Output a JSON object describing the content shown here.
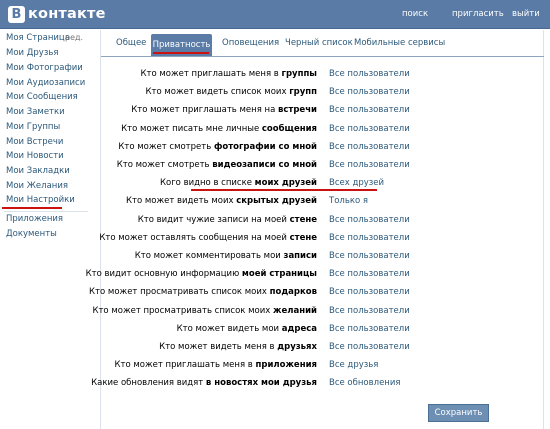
{
  "header": {
    "logo_letter": "В",
    "logo_text": "контакте",
    "links": [
      "поиск",
      "пригласить",
      "выйти"
    ]
  },
  "sidebar": {
    "edit_label": "ред.",
    "items": [
      "Моя Страница",
      "Мои Друзья",
      "Мои Фотографии",
      "Мои Аудиозаписи",
      "Мои Сообщения",
      "Мои Заметки",
      "Мои Группы",
      "Мои Встречи",
      "Мои Новости",
      "Мои Закладки",
      "Мои Желания",
      "Мои Настройки"
    ],
    "extra": [
      "Приложения",
      "Документы"
    ]
  },
  "tabs": [
    "Общее",
    "Приватность",
    "Оповещения",
    "Черный список",
    "Мобильные сервисы"
  ],
  "settings": [
    {
      "pre": "Кто может приглашать меня в ",
      "bold": "группы",
      "post": "",
      "value": "Все пользователи"
    },
    {
      "pre": "Кто может видеть список моих ",
      "bold": "групп",
      "post": "",
      "value": "Все пользователи"
    },
    {
      "pre": "Кто может приглашать меня на ",
      "bold": "встречи",
      "post": "",
      "value": "Все пользователи"
    },
    {
      "pre": "Кто может писать мне личные ",
      "bold": "сообщения",
      "post": "",
      "value": "Все пользователи"
    },
    {
      "pre": "Кто может смотреть ",
      "bold": "фотографии со мной",
      "post": "",
      "value": "Все пользователи"
    },
    {
      "pre": "Кто может смотреть ",
      "bold": "видеозаписи со мной",
      "post": "",
      "value": "Все пользователи"
    },
    {
      "pre": "Кого видно в списке ",
      "bold": "моих друзей",
      "post": "",
      "value": "Всех друзей"
    },
    {
      "pre": "Кто может видеть моих ",
      "bold": "скрытых друзей",
      "post": "",
      "value": "Только я"
    },
    {
      "pre": "Кто видит чужие записи на моей ",
      "bold": "стене",
      "post": "",
      "value": "Все пользователи"
    },
    {
      "pre": "Кто может оставлять сообщения на моей ",
      "bold": "стене",
      "post": "",
      "value": "Все пользователи"
    },
    {
      "pre": "Кто может комментировать мои ",
      "bold": "записи",
      "post": "",
      "value": "Все пользователи"
    },
    {
      "pre": "Кто видит основную информацию ",
      "bold": "моей страницы",
      "post": "",
      "value": "Все пользователи"
    },
    {
      "pre": "Кто может просматривать список моих ",
      "bold": "подарков",
      "post": "",
      "value": "Все пользователи"
    },
    {
      "pre": "Кто может просматривать список моих ",
      "bold": "желаний",
      "post": "",
      "value": "Все пользователи"
    },
    {
      "pre": "Кто может видеть мои ",
      "bold": "адреса",
      "post": "",
      "value": "Все пользователи"
    },
    {
      "pre": "Кто может видеть меня в ",
      "bold": "друзьях",
      "post": "",
      "value": "Все пользователи"
    },
    {
      "pre": "Кто может приглашать меня в ",
      "bold": "приложения",
      "post": "",
      "value": "Все друзья"
    },
    {
      "pre": "Какие обновления видят ",
      "bold": "в новостях мои друзья",
      "post": "",
      "value": "Все обновления"
    }
  ],
  "save_label": "Сохранить"
}
